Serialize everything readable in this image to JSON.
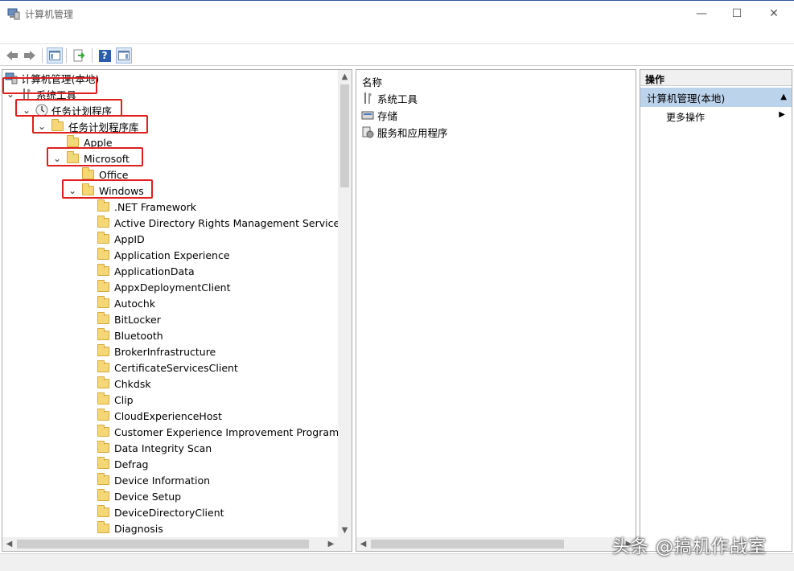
{
  "window": {
    "title": "计算机管理",
    "minimize": "—",
    "maximize": "☐",
    "close": "✕"
  },
  "toolbar": {
    "back": "◀",
    "forward": "▶",
    "help": "?"
  },
  "tree": {
    "root": "计算机管理(本地)",
    "system_tools": "系统工具",
    "task_scheduler": "任务计划程序",
    "task_library": "任务计划程序库",
    "folders_level1": [
      "Apple",
      "Microsoft"
    ],
    "office": "Office",
    "windows": "Windows",
    "windows_children": [
      ".NET Framework",
      "Active Directory Rights Management Services Cl",
      "AppID",
      "Application Experience",
      "ApplicationData",
      "AppxDeploymentClient",
      "Autochk",
      "BitLocker",
      "Bluetooth",
      "BrokerInfrastructure",
      "CertificateServicesClient",
      "Chkdsk",
      "Clip",
      "CloudExperienceHost",
      "Customer Experience Improvement Program",
      "Data Integrity Scan",
      "Defrag",
      "Device Information",
      "Device Setup",
      "DeviceDirectoryClient",
      "Diagnosis"
    ]
  },
  "middle": {
    "column_header": "名称",
    "items": [
      "系统工具",
      "存储",
      "服务和应用程序"
    ]
  },
  "actions": {
    "header": "操作",
    "section": "计算机管理(本地)",
    "more": "更多操作"
  },
  "watermark": "头条 @搞机作战室",
  "colors": {
    "highlight_box": "#e11e1e",
    "action_section_bg": "#bcd3ec",
    "folder": "#f6d776"
  }
}
